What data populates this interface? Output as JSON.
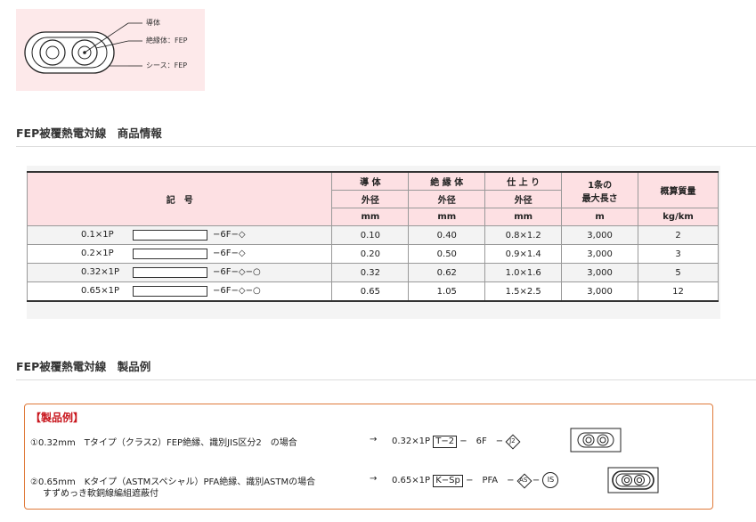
{
  "diagram": {
    "labels": [
      "導体",
      "絶縁体：FEP",
      "シース：FEP"
    ]
  },
  "section1": {
    "title": "FEP被覆熱電対線　商品情報"
  },
  "table": {
    "headers": {
      "symbol": "記　号",
      "conductor": "導 体",
      "insulator": "絶 縁 体",
      "finish": "仕 上 り",
      "maxlen": "1条の\n最大長さ",
      "mass": "概算質量"
    },
    "subheaders": {
      "conductor": "外径",
      "insulator": "外径",
      "finish": "外径"
    },
    "units": {
      "conductor": "mm",
      "insulator": "mm",
      "finish": "mm",
      "maxlen": "m",
      "mass": "kg/km"
    },
    "maxlen_line1": "1条の",
    "maxlen_line2": "最大長さ",
    "rows": [
      {
        "code": "0.1×1P",
        "suffix": "−6F−◇",
        "conductor": "0.10",
        "insulator": "0.40",
        "finish": "0.8×1.2",
        "maxlen": "3,000",
        "mass": "2"
      },
      {
        "code": "0.2×1P",
        "suffix": "−6F−◇",
        "conductor": "0.20",
        "insulator": "0.50",
        "finish": "0.9×1.4",
        "maxlen": "3,000",
        "mass": "3"
      },
      {
        "code": "0.32×1P",
        "suffix": "−6F−◇−○",
        "conductor": "0.32",
        "insulator": "0.62",
        "finish": "1.0×1.6",
        "maxlen": "3,000",
        "mass": "5"
      },
      {
        "code": "0.65×1P",
        "suffix": "−6F−◇−○",
        "conductor": "0.65",
        "insulator": "1.05",
        "finish": "1.5×2.5",
        "maxlen": "3,000",
        "mass": "12"
      }
    ]
  },
  "section2": {
    "title": "FEP被覆熱電対線　製品例"
  },
  "example": {
    "heading": "【製品例】",
    "ex1": {
      "desc": "①0.32mm　Tタイプ（クラス2）FEP絶縁、識別JIS区分2　の場合",
      "arrow": "→",
      "code": "0.32×1P",
      "box": "T−2",
      "mid": "−　6F　−",
      "diamond": "J2"
    },
    "ex2": {
      "desc": "②0.65mm　Kタイプ（ASTMスペシャル）PFA絶縁、識別ASTMの場合",
      "desc2": "すずめっき軟銅線編組遮蔽付",
      "arrow": "→",
      "code": "0.65×1P",
      "box": "K−Sp",
      "mid": "−　PFA　−",
      "diamond": "AS",
      "dash": "−",
      "circle": "IS"
    }
  },
  "colors": {
    "pink_bg": "#fde9ea",
    "header_pink": "#fde0e3",
    "accent_red": "#c8161d",
    "border_orange": "#e07a3a"
  }
}
